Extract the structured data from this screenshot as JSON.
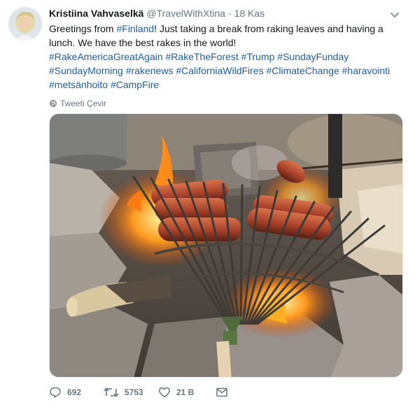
{
  "author": {
    "name": "Kristiina Vahvaselkä",
    "handle": "@TravelWithXtina",
    "separator": "·",
    "date": "18 Kas"
  },
  "tweet": {
    "line_1_prefix": "Greetings from ",
    "line_1_tag": "#Finland",
    "line_1_suffix": "! Just taking a break from raking leaves and having a lunch. We have the best rakes in the world!",
    "tags_line_1": "#RakeAmericaGreatAgain #RakeTheForest #Trump #SundayFunday",
    "tags_line_2": "#SundayMorning #rakenews #CaliforniaWildFires #ClimateChange #haravointi",
    "tags_line_3": "#metsänhoito #CampFire"
  },
  "translate_label": "Tweeti Çevir",
  "actions": {
    "replies": "692",
    "retweets": "5753",
    "likes": "21 B"
  },
  "icons": [
    "avatar",
    "chevron-down-icon",
    "globe-icon",
    "reply-icon",
    "retweet-icon",
    "heart-icon",
    "message-icon"
  ],
  "colors": {
    "hashtag": "#1b5fa7",
    "muted": "#657786",
    "text": "#14171a"
  }
}
